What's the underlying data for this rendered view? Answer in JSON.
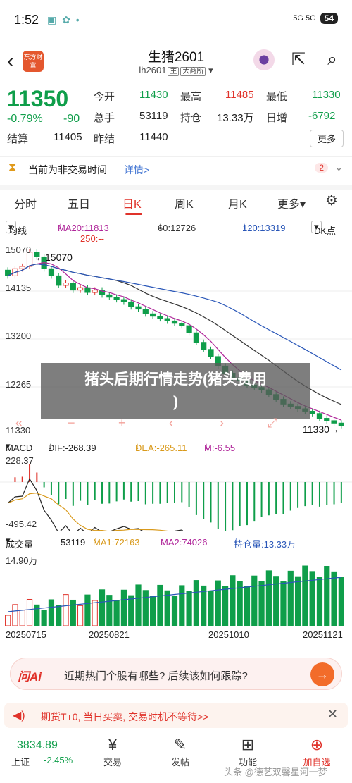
{
  "status": {
    "time": "1:52",
    "signal": "5G 5G",
    "battery": "54"
  },
  "nav": {
    "back_icon": "back-chevron",
    "logo_text": "东方财富",
    "title": "生猪2601",
    "subtitle_code": "lh2601",
    "subtitle_tag1": "主",
    "subtitle_tag2": "大商所"
  },
  "quote": {
    "price": "11350",
    "change_pct": "-0.79%",
    "change_abs": "-90",
    "settle_label": "结算",
    "settle": "11405",
    "prev_settle_label": "昨结",
    "prev_settle": "11440",
    "open_label": "今开",
    "open": "11430",
    "high_label": "最高",
    "high": "11485",
    "low_label": "最低",
    "low": "11330",
    "volume_label": "总手",
    "volume": "53119",
    "oi_label": "持仓",
    "oi": "13.33万",
    "daily_inc_label": "日增",
    "daily_inc": "-6792",
    "more_label": "更多"
  },
  "notice": {
    "text": "当前为非交易时间",
    "link": "详情>",
    "badge": "2"
  },
  "tabs": [
    "分时",
    "五日",
    "日K",
    "周K",
    "月K",
    "更多"
  ],
  "active_tab": 2,
  "ma_row": {
    "type": "均线",
    "ma20": "MA20:11813",
    "ma60": "60:12726",
    "ma120": "120:13319",
    "ma250": "250:--",
    "dk": "DK点"
  },
  "price_axis": [
    "15070",
    "14135",
    "13200",
    "12265",
    "11330"
  ],
  "price_markers": {
    "high": "15070",
    "low": "11330"
  },
  "macd_row": {
    "name": "MACD",
    "dif": "DIF:-268.39",
    "dea": "DEA:-265.11",
    "m": "M:-6.55"
  },
  "macd_axis": {
    "top": "228.37",
    "bottom": "-495.42"
  },
  "vol_row": {
    "name": "成交量",
    "vol": "53119",
    "ma1": "MA1:72163",
    "ma2": "MA2:74026",
    "oi": "持仓量:13.33万"
  },
  "vol_axis": {
    "top": "14.90万"
  },
  "dates": [
    "20250715",
    "20250821",
    "20251010",
    "20251121"
  ],
  "overlay": {
    "line1": "猪头后期行情走势(猪头费用",
    "line2": ")"
  },
  "ai_bar": {
    "brand": "问Ai",
    "question": "近期热门个股有哪些? 后续该如何跟踪?"
  },
  "promo": {
    "text": "期货T+0, 当日买卖, 交易时机不等待>>"
  },
  "bottom": {
    "index_value": "3834.89",
    "index_name": "上证",
    "index_change": "-2.45%",
    "items": [
      "交易",
      "发帖",
      "功能",
      "加自选"
    ]
  },
  "watermark": "头条 @德艺双馨星河一梦",
  "chart_data": [
    {
      "type": "candlestick",
      "title": "生猪2601 日K",
      "x_range": [
        "20250715",
        "20251121"
      ],
      "y_range": [
        11330,
        15070
      ],
      "ma_lines": [
        "MA20",
        "60",
        "120",
        "250"
      ],
      "close": [
        14500,
        14650,
        14700,
        15000,
        14900,
        14650,
        14500,
        14300,
        14350,
        14200,
        14250,
        14150,
        14200,
        14100,
        14050,
        14000,
        13950,
        13850,
        13800,
        13700,
        13650,
        13600,
        13550,
        13500,
        13450,
        13300,
        13100,
        12950,
        12800,
        12600,
        12450,
        12350,
        12300,
        12200,
        12150,
        12100,
        12000,
        11900,
        11800,
        11750,
        11700,
        11650,
        11600,
        11500,
        11450,
        11400,
        11350
      ]
    },
    {
      "type": "line",
      "title": "MACD",
      "series": [
        {
          "name": "DIF"
        },
        {
          "name": "DEA"
        }
      ],
      "ylim": [
        -495.42,
        228.37
      ]
    },
    {
      "type": "bar",
      "title": "成交量",
      "ylim": [
        0,
        149000
      ],
      "series": [
        {
          "name": "MA1"
        },
        {
          "name": "MA2"
        }
      ]
    }
  ]
}
